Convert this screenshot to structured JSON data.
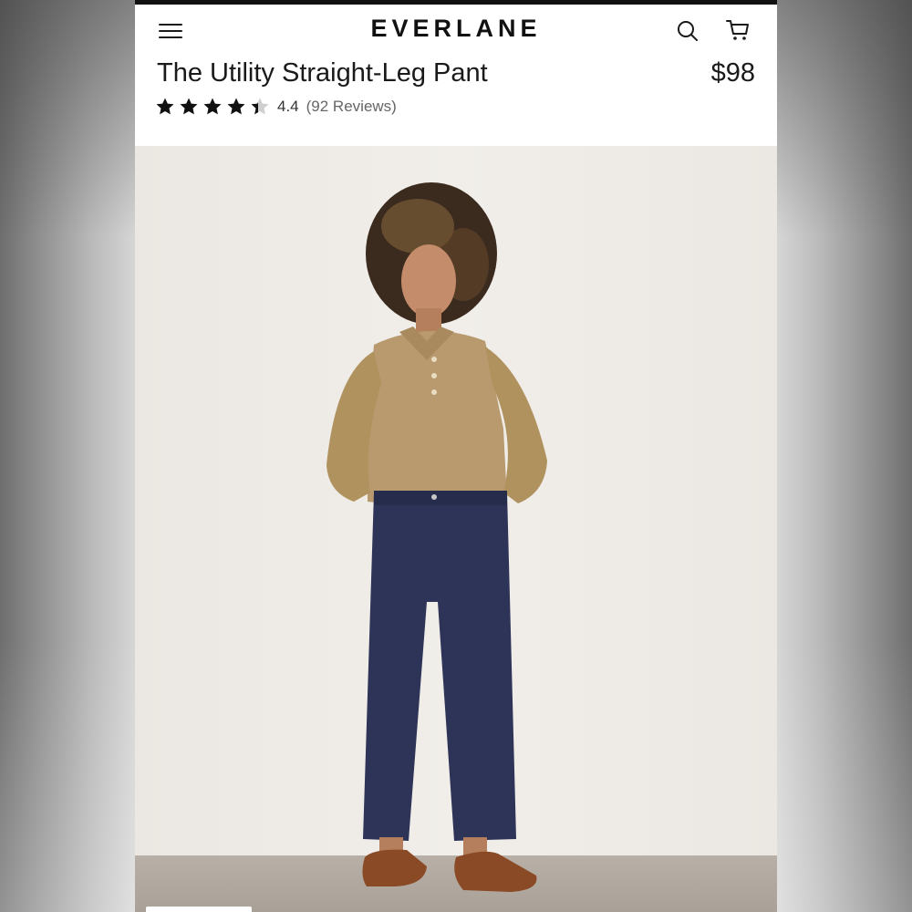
{
  "header": {
    "brand": "EVERLANE",
    "menu_icon": "hamburger-menu-icon",
    "search_icon": "search-icon",
    "cart_icon": "shopping-cart-icon"
  },
  "product": {
    "title": "The Utility Straight-Leg Pant",
    "price": "$98",
    "rating": {
      "value": "4.4",
      "stars": 4.4,
      "max_stars": 5,
      "reviews_text": "(92 Reviews)"
    }
  },
  "colors": {
    "text": "#1a1a1a",
    "top_rule": "#111111",
    "sweater": "#b89a6e",
    "pants": "#2e3457",
    "loafers": "#8b4a26"
  }
}
